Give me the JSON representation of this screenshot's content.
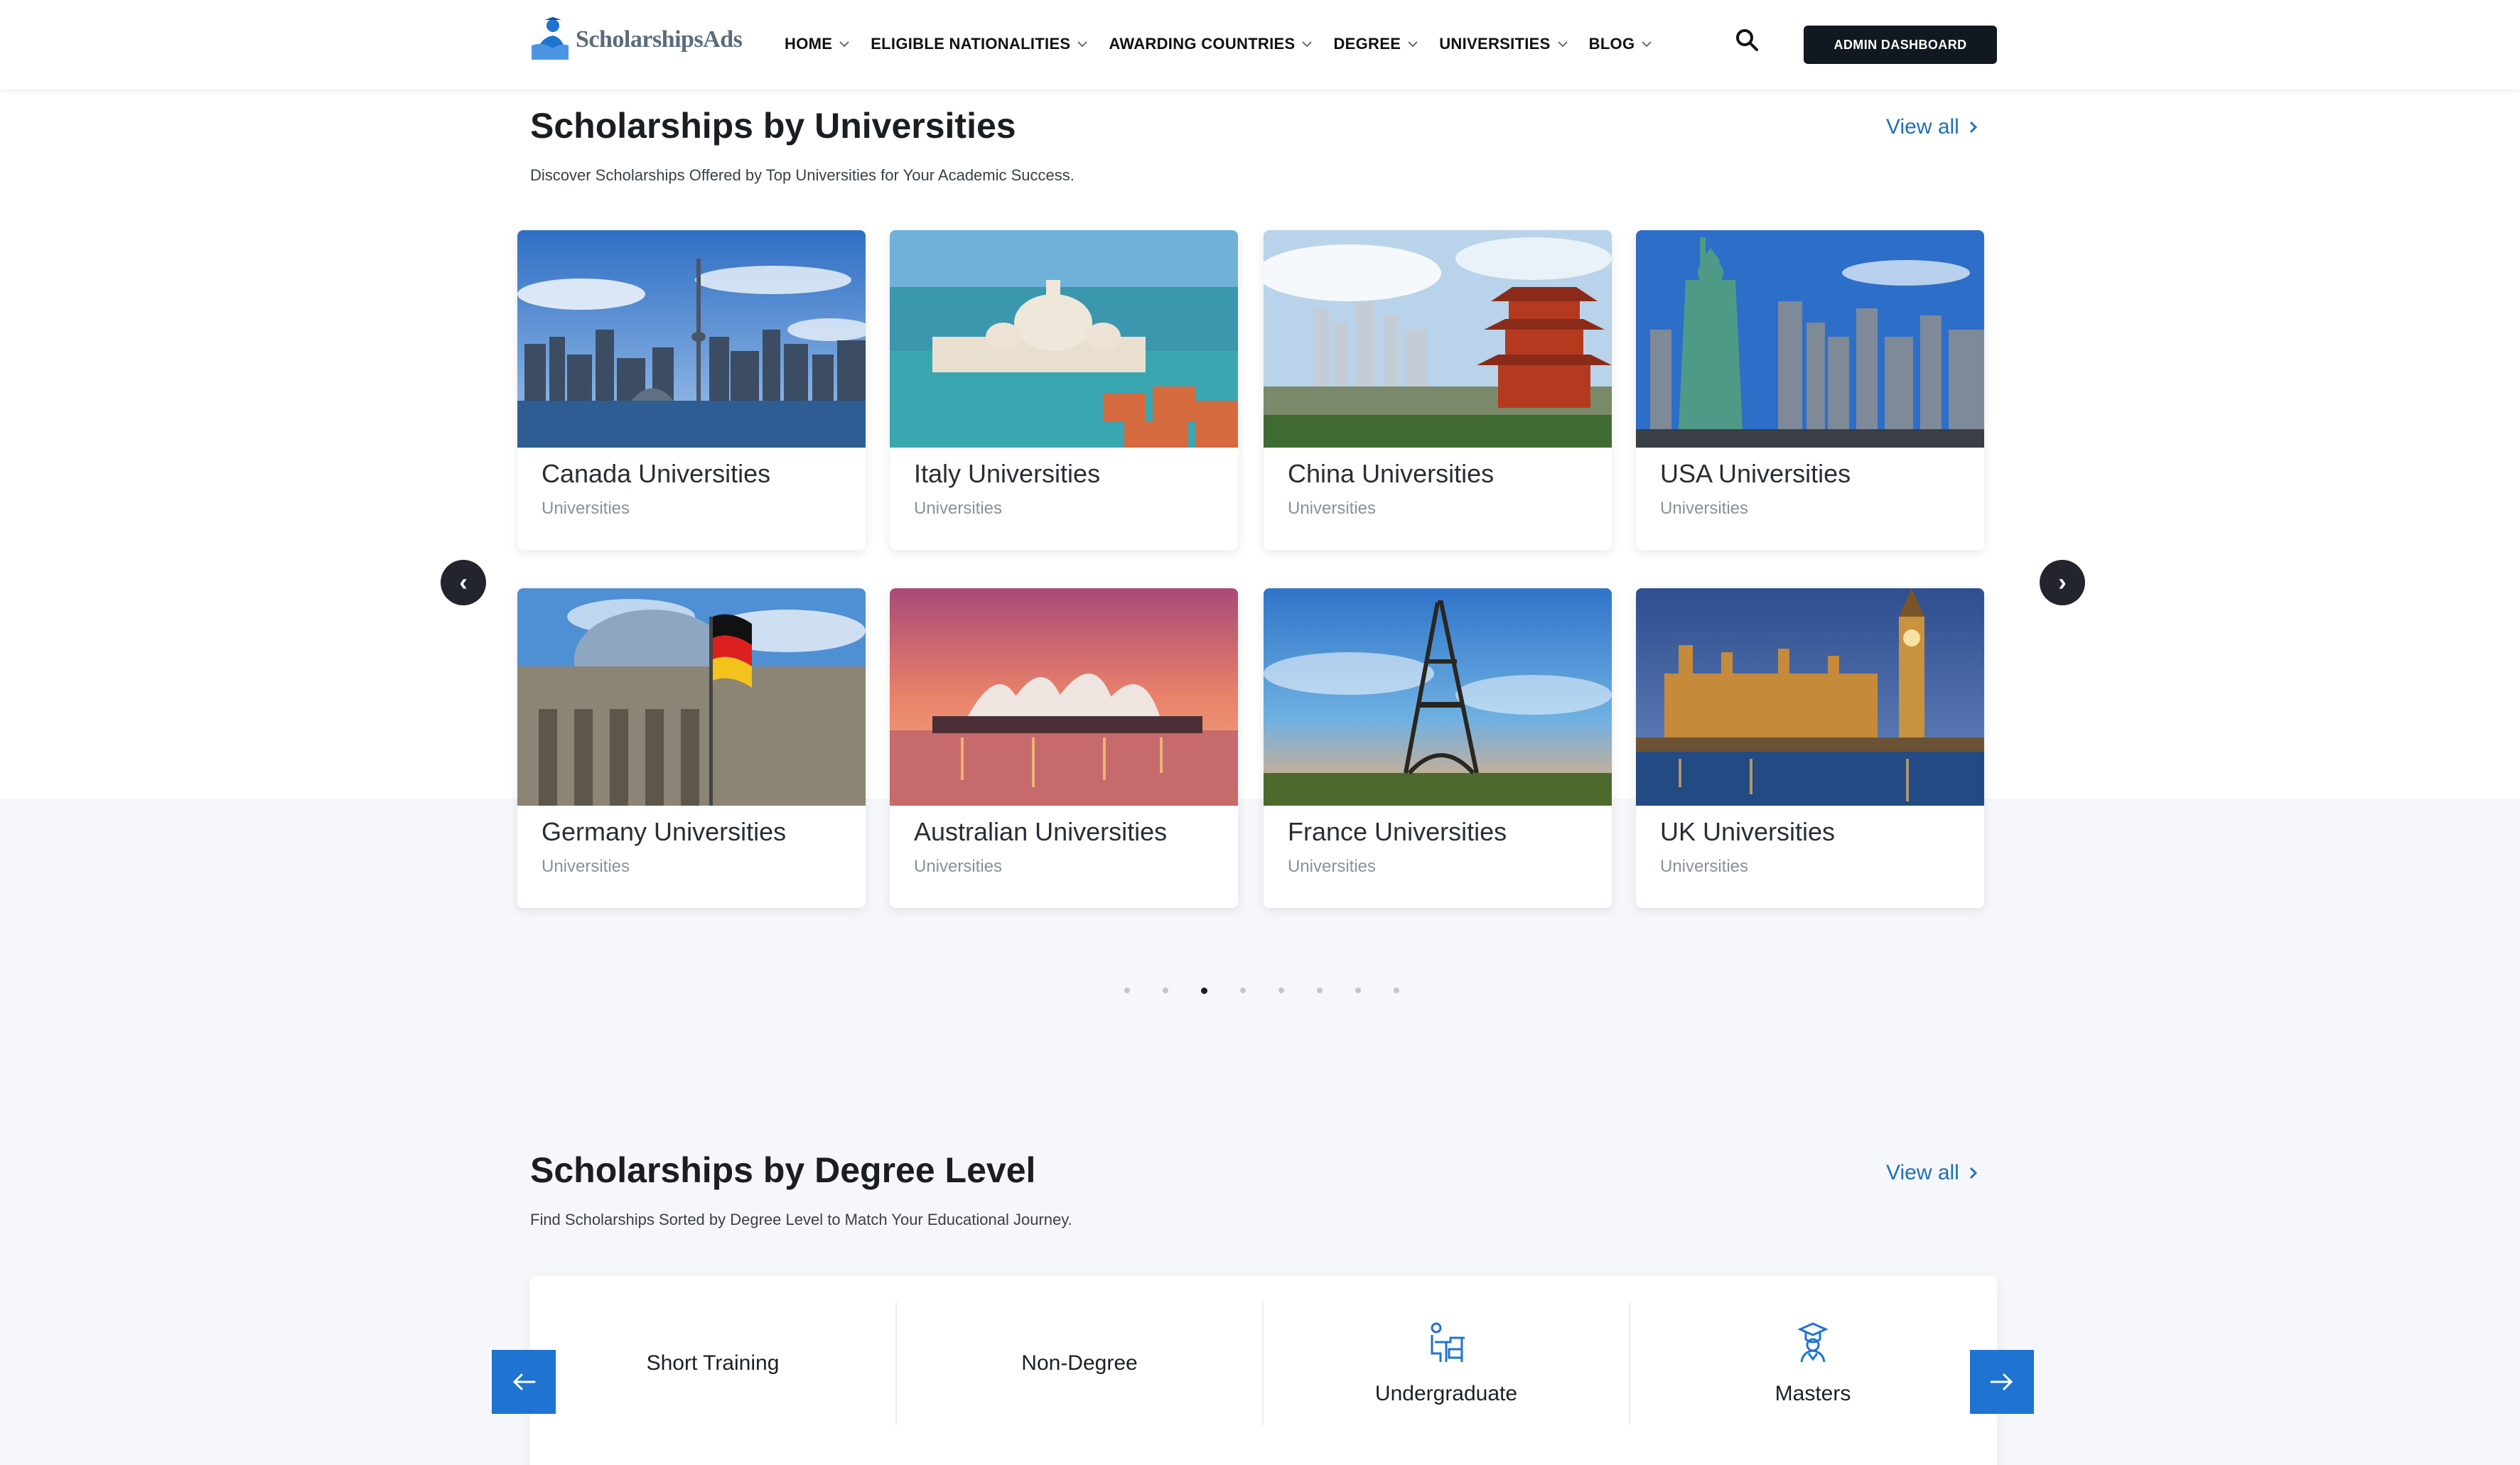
{
  "brand": {
    "name": "ScholarshipsAds",
    "accent": "#1f73d1",
    "dark": "#111820"
  },
  "nav": {
    "items": [
      {
        "label": "HOME"
      },
      {
        "label": "ELIGIBLE NATIONALITIES"
      },
      {
        "label": "AWARDING COUNTRIES"
      },
      {
        "label": "DEGREE"
      },
      {
        "label": "UNIVERSITIES"
      },
      {
        "label": "BLOG"
      }
    ],
    "search_icon": "search-icon",
    "admin_label": "ADMIN DASHBOARD"
  },
  "universities_section": {
    "title": "Scholarships by Universities",
    "subtitle": "Discover Scholarships Offered by Top Universities for Your Academic Success.",
    "view_all": "View all",
    "prev_glyph": "‹",
    "next_glyph": "›",
    "cards": [
      {
        "title": "Canada Universities",
        "tag": "Universities",
        "image": "toronto-skyline"
      },
      {
        "title": "Italy Universities",
        "tag": "Universities",
        "image": "venice-basilica"
      },
      {
        "title": "China Universities",
        "tag": "Universities",
        "image": "chinese-pagoda-skyline"
      },
      {
        "title": "USA Universities",
        "tag": "Universities",
        "image": "statue-of-liberty"
      },
      {
        "title": "Germany Universities",
        "tag": "Universities",
        "image": "reichstag-flag"
      },
      {
        "title": "Australian Universities",
        "tag": "Universities",
        "image": "sydney-opera-house"
      },
      {
        "title": "France Universities",
        "tag": "Universities",
        "image": "eiffel-tower"
      },
      {
        "title": "UK Universities",
        "tag": "Universities",
        "image": "westminster-big-ben"
      }
    ],
    "pagination": {
      "pages": 8,
      "current": 3
    }
  },
  "degree_section": {
    "title": "Scholarships by Degree Level",
    "subtitle": "Find Scholarships Sorted by Degree Level to Match Your Educational Journey.",
    "view_all": "View all",
    "items": [
      {
        "label": "Short Training",
        "icon": ""
      },
      {
        "label": "Non-Degree",
        "icon": ""
      },
      {
        "label": "Undergraduate",
        "icon": "student-desk-icon"
      },
      {
        "label": "Masters",
        "icon": "graduate-icon"
      }
    ]
  }
}
